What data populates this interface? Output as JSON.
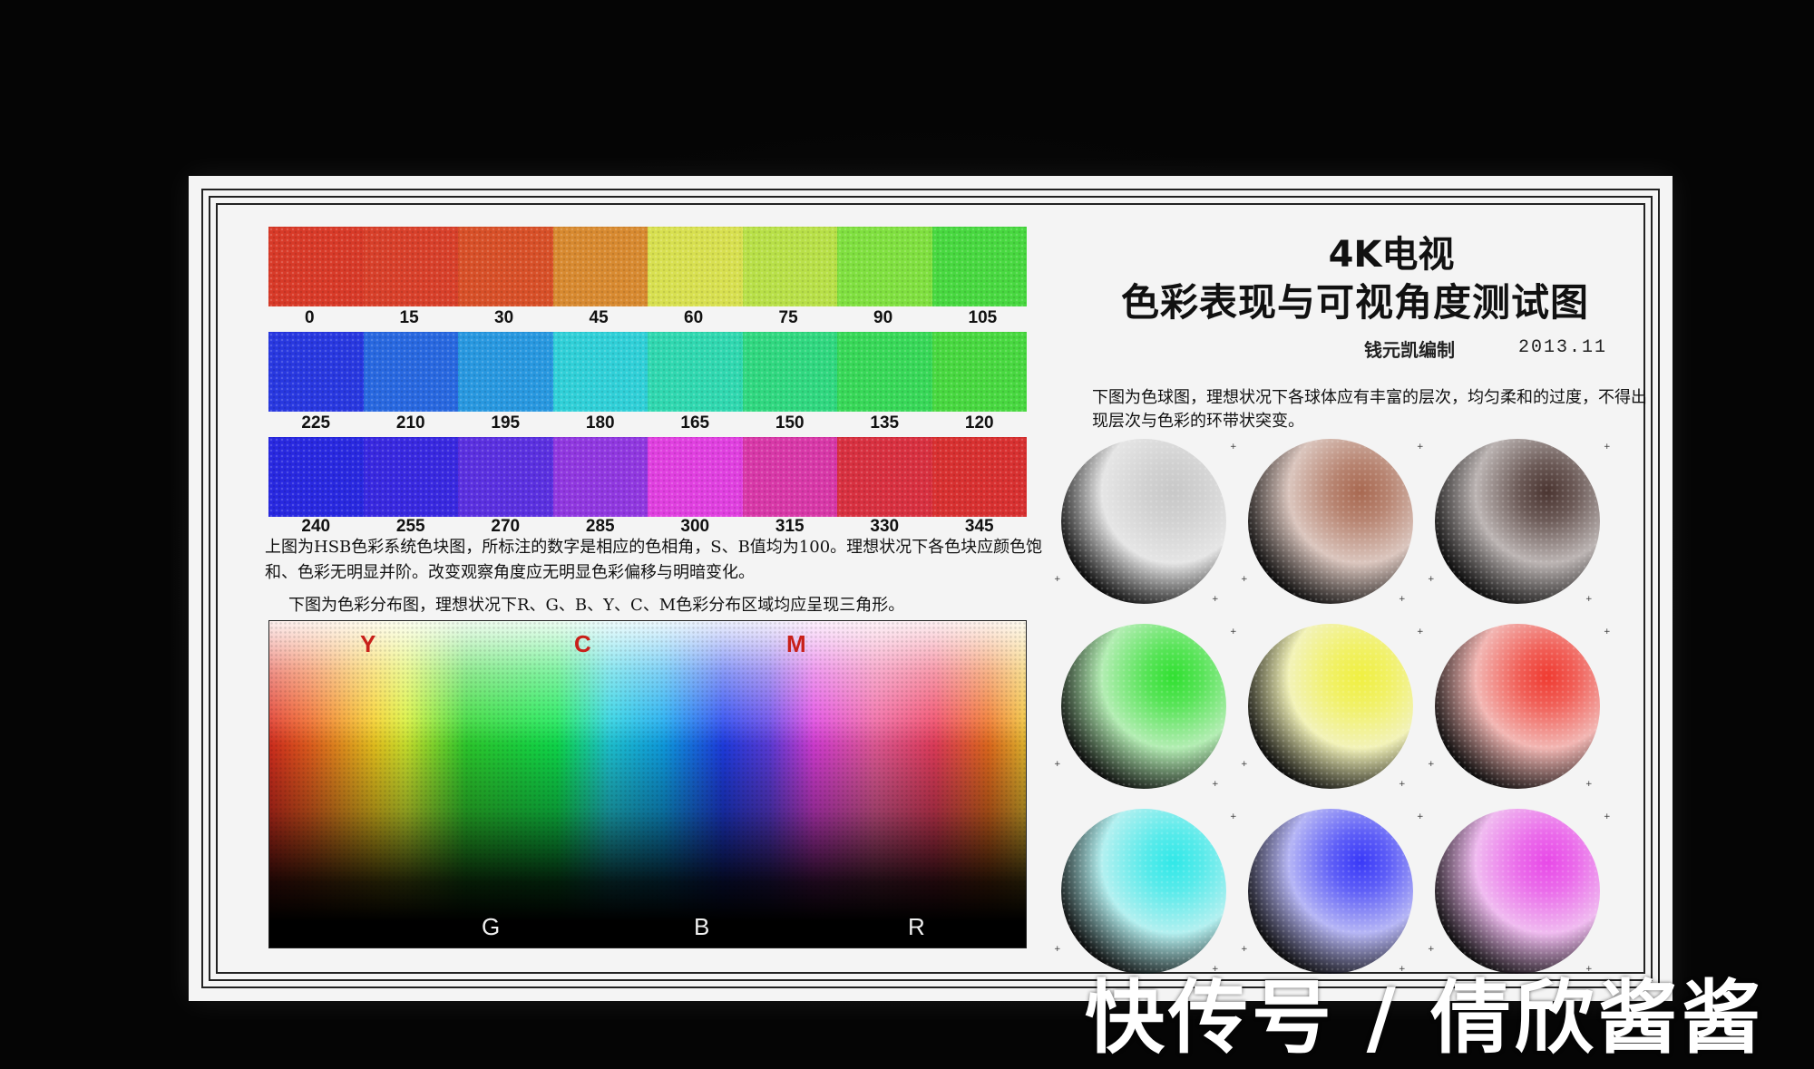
{
  "hue_rows": [
    {
      "hues": [
        "0",
        "15",
        "30",
        "45",
        "60",
        "75",
        "90",
        "105"
      ],
      "colors": [
        "#d83a28",
        "#d8402a",
        "#d85028",
        "#d88a30",
        "#d8e050",
        "#b8e048",
        "#80e040",
        "#48d840"
      ]
    },
    {
      "hues": [
        "225",
        "210",
        "195",
        "180",
        "165",
        "150",
        "135",
        "120"
      ],
      "colors": [
        "#2838e0",
        "#2868e0",
        "#2898e0",
        "#30d0d8",
        "#30d8b0",
        "#30d880",
        "#38d858",
        "#48d840"
      ]
    },
    {
      "hues": [
        "240",
        "255",
        "270",
        "285",
        "300",
        "315",
        "330",
        "345"
      ],
      "colors": [
        "#2828e0",
        "#3828e0",
        "#5a30e0",
        "#9038e0",
        "#e040e0",
        "#d838a8",
        "#d83040",
        "#d83030"
      ]
    }
  ],
  "hsb_description": "上图为HSB色彩系统色块图，所标注的数字是相应的色相角，S、B值均为100。理想状况下各色块应颜色饱和、色彩无明显并阶。改变观察角度应无明显色彩偏移与明暗变化。",
  "gamut_caption": "下图为色彩分布图，理想状况下R、G、B、Y、C、M色彩分布区域均应呈现三角形。",
  "gamut": {
    "top_labels": [
      "Y",
      "C",
      "M"
    ],
    "bottom_labels": [
      "G",
      "B",
      "R"
    ]
  },
  "title_line1": "4K电视",
  "title_line2": "色彩表现与可视角度测试图",
  "author": "钱元凯编制",
  "date": "2013.11",
  "ball_description": "下图为色球图，理想状况下各球体应有丰富的层次，均匀柔和的过度，不得出现层次与色彩的环带状突变。",
  "balls": [
    {
      "name": "gray",
      "color": "#c8c8c8"
    },
    {
      "name": "brown",
      "color": "#a86850"
    },
    {
      "name": "dark-brown",
      "color": "#4a3430"
    },
    {
      "name": "green",
      "color": "#30e030"
    },
    {
      "name": "yellow",
      "color": "#f0f040"
    },
    {
      "name": "red",
      "color": "#f03a30"
    },
    {
      "name": "cyan",
      "color": "#30e8e8"
    },
    {
      "name": "blue",
      "color": "#3838f8"
    },
    {
      "name": "magenta",
      "color": "#e848e8"
    }
  ],
  "watermark": "快传号 / 倩欣酱酱"
}
